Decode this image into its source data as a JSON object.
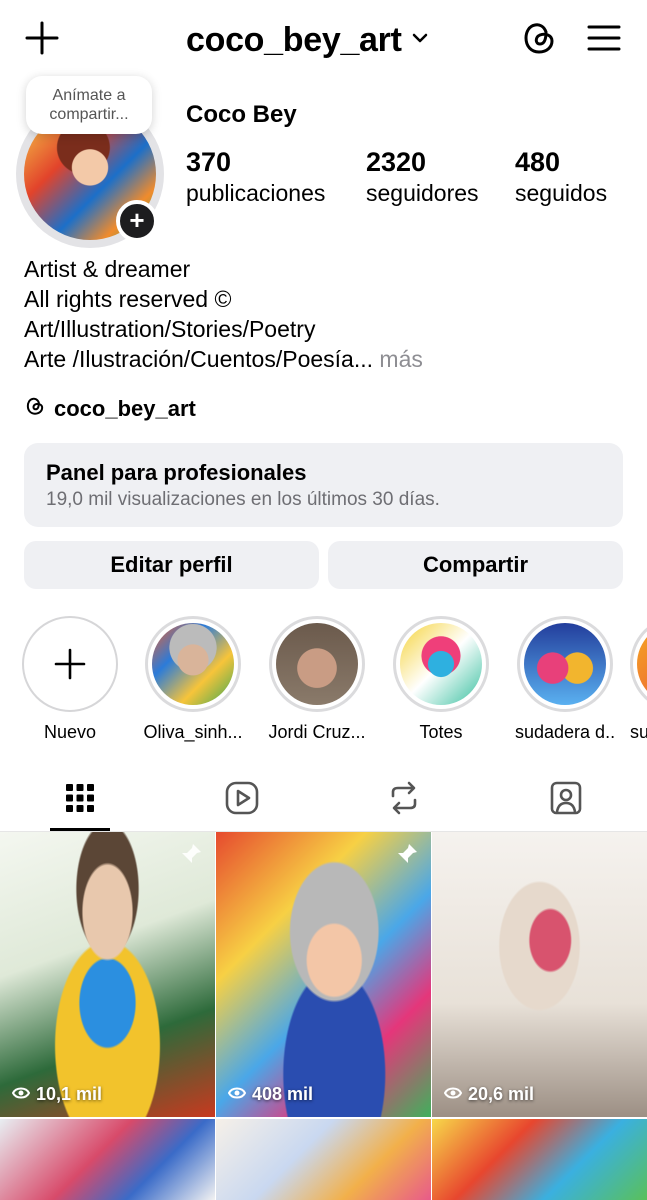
{
  "header": {
    "username": "coco_bey_art"
  },
  "profile": {
    "note": "Anímate a compartir...",
    "display_name": "Coco Bey",
    "stats": [
      {
        "value": "370",
        "label": "publicaciones"
      },
      {
        "value": "2320",
        "label": "seguidores"
      },
      {
        "value": "480",
        "label": "seguidos"
      }
    ],
    "bio_lines": [
      "Artist & dreamer",
      "All rights reserved ©",
      "Art/Illustration/Stories/Poetry",
      "Arte /Ilustración/Cuentos/Poesía..."
    ],
    "bio_more": "más",
    "threads_handle": "coco_bey_art"
  },
  "panel": {
    "title": "Panel para profesionales",
    "subtitle": "19,0 mil visualizaciones en los últimos 30 días."
  },
  "buttons": {
    "edit": "Editar perfil",
    "share": "Compartir"
  },
  "highlights": [
    {
      "label": "Nuevo"
    },
    {
      "label": "Oliva_sinh..."
    },
    {
      "label": "Jordi Cruz..."
    },
    {
      "label": "Totes"
    },
    {
      "label": "sudadera d..."
    },
    {
      "label": "su"
    }
  ],
  "grid": [
    {
      "views": "10,1 mil",
      "pinned": true
    },
    {
      "views": "408 mil",
      "pinned": true
    },
    {
      "views": "20,6 mil",
      "pinned": false
    }
  ],
  "colors": {
    "accent_text": "#000000",
    "muted_text": "#8e8e93",
    "panel_bg": "#eff0f3"
  }
}
